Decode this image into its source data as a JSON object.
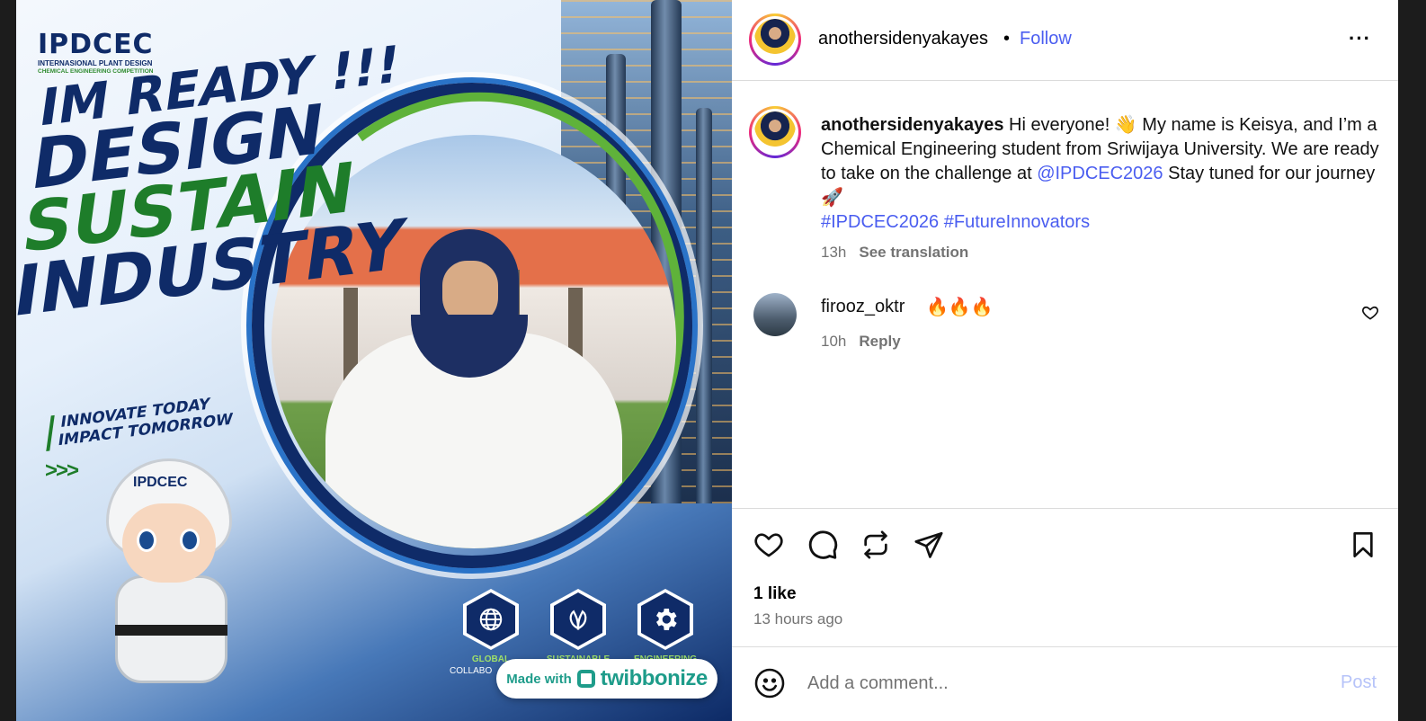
{
  "post_image": {
    "logo": "IPDCEC",
    "logo_sub1": "INTERNASIONAL PLANT DESIGN",
    "logo_sub2": "CHEMICAL ENGINEERING COMPETITION",
    "headline": [
      "IM READY !!!",
      "DESIGN",
      "SUSTAIN",
      "INDUSTRY"
    ],
    "tagline": [
      "INNOVATE TODAY",
      "IMPACT TOMORROW"
    ],
    "chevrons": ">>>",
    "mascot_badge": "IPDCEC",
    "icons": [
      {
        "icon": "globe-icon",
        "caption": "GLOBAL",
        "caption2": "COLLABO"
      },
      {
        "icon": "leaf-icon",
        "caption": "SUSTAINABLE",
        "caption2": ""
      },
      {
        "icon": "gear-icon",
        "caption": "ENGINEERING",
        "caption2": ""
      }
    ],
    "made_with_label": "Made with",
    "made_with_brand": "twibbonize"
  },
  "header": {
    "username": "anothersidenyakayes",
    "separator": "•",
    "follow_label": "Follow",
    "more_label": "···"
  },
  "caption": {
    "username": "anothersidenyakayes",
    "text_before": " Hi everyone! 👋 My name is Keisya, and I’m a Chemical Engineering student from Sriwijaya University. We are ready to take on the challenge at ",
    "mention": "@IPDCEC2026",
    "text_after": " Stay tuned for our journey 🚀",
    "hashtag1": "#IPDCEC2026",
    "hashtag2": "#FutureInnovators",
    "time": "13h",
    "see_translation": "See translation"
  },
  "comment": {
    "username": "firooz_oktr",
    "text": "🔥🔥🔥",
    "time": "10h",
    "reply_label": "Reply"
  },
  "actions": {
    "likes": "1 like",
    "time_ago": "13 hours ago"
  },
  "add_comment": {
    "placeholder": "Add a comment...",
    "post_label": "Post"
  },
  "colors": {
    "link": "#4a5df0",
    "post_disabled": "#b6c3f9",
    "muted": "#737373",
    "brand_navy": "#0f2b68",
    "brand_green": "#1e7d2a"
  }
}
